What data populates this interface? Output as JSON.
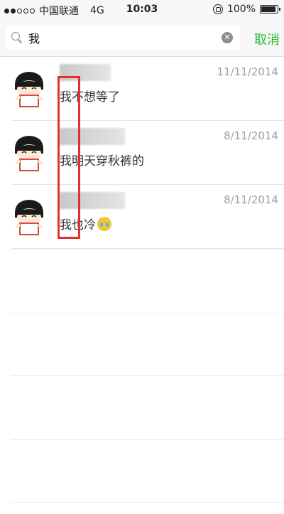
{
  "status_bar": {
    "carrier": "中国联通",
    "network": "4G",
    "time": "10:03",
    "battery": "100%",
    "signal_bars_filled": 2,
    "signal_bars_total": 5,
    "battery_level": 1.0
  },
  "search": {
    "query": "我",
    "cancel_label": "取消"
  },
  "results": [
    {
      "preview": "我不想等了",
      "date": "11/11/2014",
      "has_emoji": false
    },
    {
      "preview": "我明天穿秋裤的",
      "date": "8/11/2014",
      "has_emoji": false
    },
    {
      "preview": "我也冷",
      "date": "8/11/2014",
      "has_emoji": true
    }
  ],
  "colors": {
    "accent": "#2fb83d",
    "highlight": "#e23030",
    "date_text": "#a0a0a0"
  }
}
